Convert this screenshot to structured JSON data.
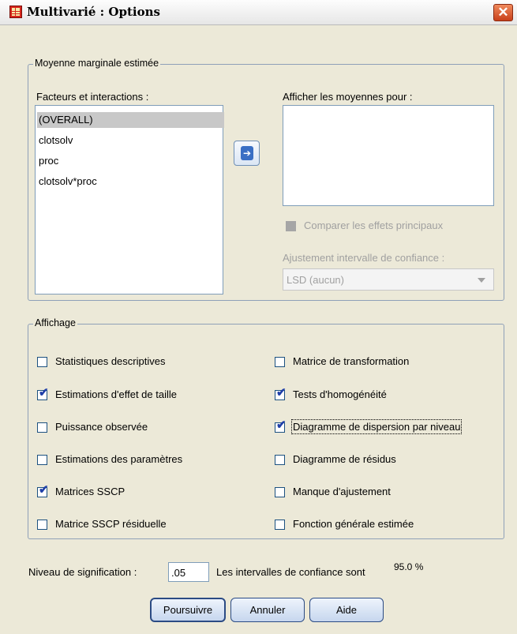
{
  "window": {
    "title": "Multivarié : Options",
    "close_glyph": "✕"
  },
  "emm": {
    "legend": "Moyenne marginale estimée",
    "factors_label": "Facteurs et interactions :",
    "factors": [
      "(OVERALL)",
      "clotsolv",
      "proc",
      "clotsolv*proc"
    ],
    "selected_factor": "(OVERALL)",
    "display_means_label": "Afficher les moyennes pour :",
    "move_arrow_glyph": "➔",
    "compare_main_effects": {
      "label": "Comparer les effets principaux",
      "checked": false,
      "enabled": false
    },
    "ci_adjustment_label": "Ajustement intervalle de confiance :",
    "ci_adjustment_value": "LSD (aucun)"
  },
  "display": {
    "legend": "Affichage",
    "left": [
      {
        "label": "Statistiques descriptives",
        "checked": false
      },
      {
        "label": "Estimations d'effet de taille",
        "checked": true
      },
      {
        "label": "Puissance observée",
        "checked": false
      },
      {
        "label": "Estimations des paramètres",
        "checked": false
      },
      {
        "label": "Matrices SSCP",
        "checked": true
      },
      {
        "label": "Matrice SSCP résiduelle",
        "checked": false
      }
    ],
    "right": [
      {
        "label": "Matrice de transformation",
        "checked": false
      },
      {
        "label": "Tests d'homogénéité",
        "checked": true
      },
      {
        "label": "Diagramme de dispersion par niveau",
        "checked": true
      },
      {
        "label": "Diagramme de résidus",
        "checked": false
      },
      {
        "label": "Manque d'ajustement",
        "checked": false
      },
      {
        "label": "Fonction générale estimée",
        "checked": false
      }
    ]
  },
  "significance": {
    "label": "Niveau de signification :",
    "value": ".05",
    "ci_text": "Les intervalles de confiance sont",
    "ci_value": "95.0",
    "ci_unit": "%"
  },
  "buttons": {
    "continue": "Poursuivre",
    "cancel": "Annuler",
    "help": "Aide"
  },
  "check_glyph": "✔"
}
